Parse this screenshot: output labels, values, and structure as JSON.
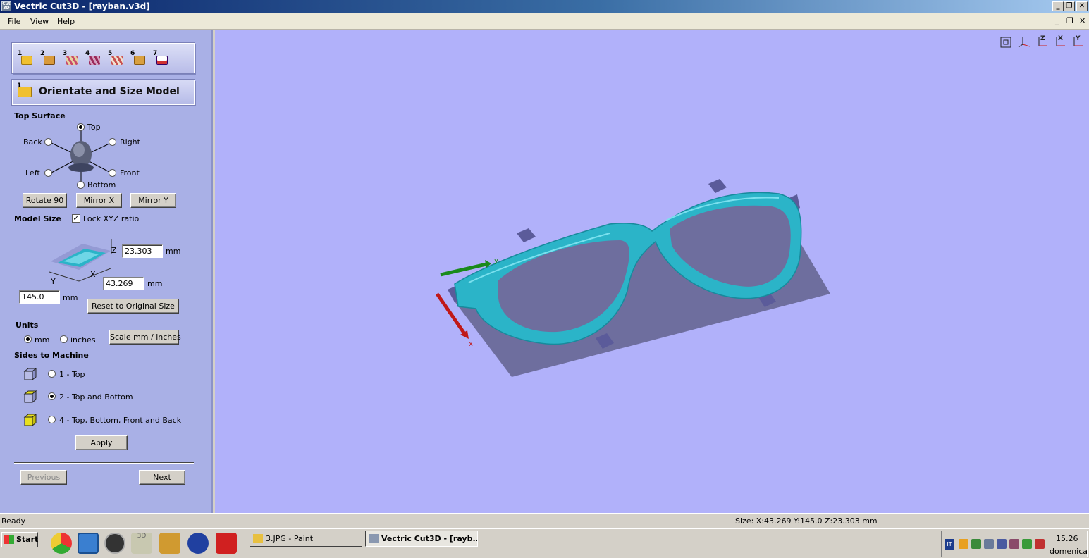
{
  "window": {
    "title": "Vectric Cut3D - [rayban.v3d]",
    "app_icon_text": "Cut 3D",
    "controls": [
      "_",
      "❐",
      "✕"
    ]
  },
  "menu": {
    "items": [
      "File",
      "View",
      "Help"
    ],
    "mdi_controls": [
      "_",
      "❐",
      "✕"
    ]
  },
  "steps": {
    "numbers": [
      "1",
      "2",
      "3",
      "4",
      "5",
      "6",
      "7"
    ],
    "icons": [
      "open-folder-icon",
      "package-icon",
      "toolpath-layer-icon",
      "toolpath-layer-icon",
      "toolpath-layer-icon",
      "material-icon",
      "save-disk-icon"
    ]
  },
  "panel": {
    "step_number": "1",
    "title": "Orientate and Size Model",
    "top_surface": {
      "heading": "Top Surface",
      "options": {
        "top": "Top",
        "back": "Back",
        "right": "Right",
        "left": "Left",
        "front": "Front",
        "bottom": "Bottom"
      },
      "selected": "top"
    },
    "buttons": {
      "rotate": "Rotate 90",
      "mirror_x": "Mirror X",
      "mirror_y": "Mirror Y"
    },
    "model_size": {
      "heading": "Model Size",
      "lock_label": "Lock XYZ ratio",
      "lock_checked": true,
      "axis_labels": {
        "z": "Z",
        "x": "X",
        "y": "Y"
      },
      "z_value": "23.303",
      "x_value": "43.269",
      "y_value": "145.0",
      "unit": "mm",
      "reset_label": "Reset to Original Size"
    },
    "units": {
      "heading": "Units",
      "mm_label": "mm",
      "inches_label": "inches",
      "selected": "mm",
      "scale_label": "Scale mm / inches"
    },
    "sides": {
      "heading": "Sides to Machine",
      "options": [
        "1 - Top",
        "2 - Top and Bottom",
        "4 - Top, Bottom, Front and Back"
      ],
      "selected_index": 1
    },
    "apply_label": "Apply",
    "previous_label": "Previous",
    "next_label": "Next"
  },
  "viewport": {
    "background": "#b1b1fa",
    "model_color": "#2bb4c8",
    "block_color": "#6e6e9e",
    "axis_x_label": "x",
    "axis_y_label": "y",
    "view_icons": [
      "zoom-fit-icon",
      "iso-view-icon",
      "z-view-icon",
      "x-view-icon",
      "y-view-icon"
    ],
    "view_icon_labels": [
      "",
      "",
      "Z",
      "X",
      "Y"
    ]
  },
  "status": {
    "left": "Ready",
    "size": "Size: X:43.269 Y:145.0 Z:23.303 mm"
  },
  "taskbar": {
    "start_label": "Start",
    "tasks": [
      "3.JPG - Paint",
      "Vectric Cut3D - [rayb..."
    ],
    "active_task_index": 1,
    "quicklaunch_icons": [
      "chrome-icon",
      "internet-explorer-icon",
      "speedometer-icon",
      "cut3d-icon",
      "aspire-icon",
      "compass-icon",
      "sketchup-icon"
    ],
    "clock": "15.26",
    "day": "domenica",
    "language": "IT"
  }
}
